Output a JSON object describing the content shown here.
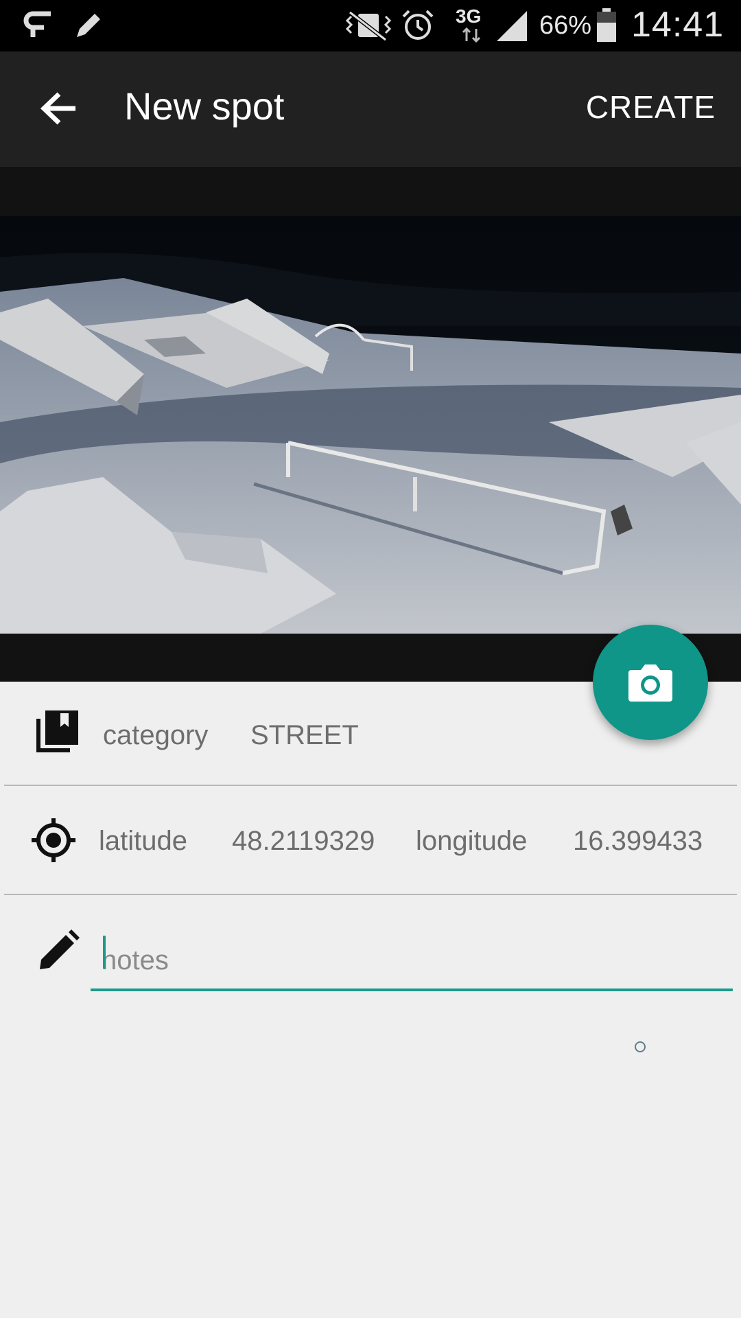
{
  "status_bar": {
    "battery_percent": "66%",
    "time": "14:41",
    "network": "3G",
    "icons": [
      "will-app-icon",
      "pencil-notification-icon",
      "vibrate-mute-icon",
      "alarm-icon",
      "network-3g-icon",
      "signal-icon",
      "battery-icon"
    ]
  },
  "app_bar": {
    "title": "New spot",
    "create_label": "CREATE",
    "back_icon": "arrow-back-icon"
  },
  "photo": {
    "description_icon": "spot-photo",
    "fab_icon": "camera-icon",
    "fab_color": "#0f9688"
  },
  "category": {
    "label": "category",
    "value": "STREET",
    "icon": "collections-bookmark-icon"
  },
  "location": {
    "latitude_label": "latitude",
    "latitude_value": "48.2119329",
    "longitude_label": "longitude",
    "longitude_value": "16.399433",
    "icon": "gps-target-icon"
  },
  "notes": {
    "placeholder": "notes",
    "value": "",
    "icon": "edit-pencil-icon",
    "accent_color": "#1c9a8a"
  }
}
